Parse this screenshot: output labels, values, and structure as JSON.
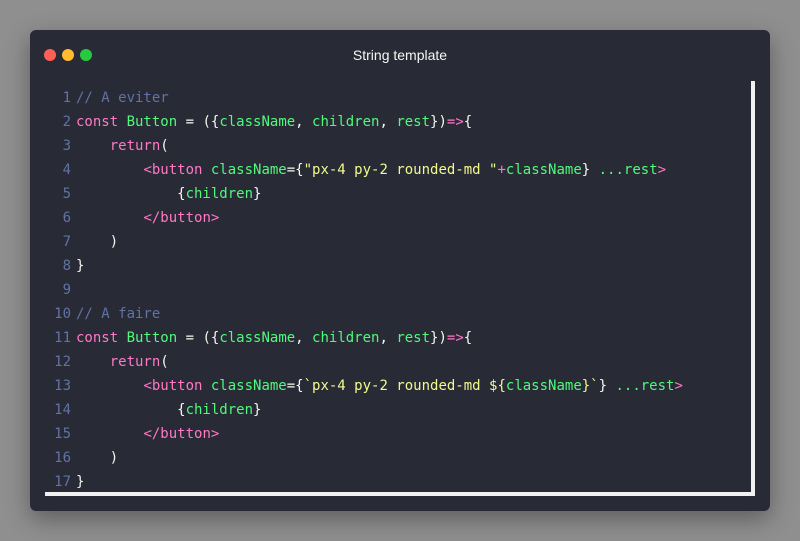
{
  "window": {
    "title": "String template"
  },
  "colors": {
    "background": "#282a36",
    "comment": "#6272a4",
    "keyword": "#ff79c6",
    "identifier": "#50fa7b",
    "string": "#f1fa8c",
    "plain": "#f8f8f2"
  },
  "icons": [
    "close-dot",
    "minimize-dot",
    "maximize-dot"
  ],
  "code": {
    "lines": [
      {
        "n": "1",
        "tokens": [
          {
            "t": "// A eviter",
            "c": "comment"
          }
        ]
      },
      {
        "n": "2",
        "tokens": [
          {
            "t": "const ",
            "c": "kw"
          },
          {
            "t": "Button",
            "c": "id"
          },
          {
            "t": " = ({",
            "c": "pl"
          },
          {
            "t": "className",
            "c": "id"
          },
          {
            "t": ", ",
            "c": "pl"
          },
          {
            "t": "children",
            "c": "id"
          },
          {
            "t": ", ",
            "c": "pl"
          },
          {
            "t": "rest",
            "c": "id"
          },
          {
            "t": "})",
            "c": "pl"
          },
          {
            "t": "=>",
            "c": "kw"
          },
          {
            "t": "{",
            "c": "pl"
          }
        ]
      },
      {
        "n": "3",
        "tokens": [
          {
            "t": "    ",
            "c": "pl"
          },
          {
            "t": "return",
            "c": "kw"
          },
          {
            "t": "(",
            "c": "pl"
          }
        ]
      },
      {
        "n": "4",
        "tokens": [
          {
            "t": "        ",
            "c": "pl"
          },
          {
            "t": "<button ",
            "c": "kw"
          },
          {
            "t": "className",
            "c": "id"
          },
          {
            "t": "={",
            "c": "pl"
          },
          {
            "t": "\"px-4 py-2 rounded-md \"",
            "c": "str"
          },
          {
            "t": "+",
            "c": "kw"
          },
          {
            "t": "className",
            "c": "id"
          },
          {
            "t": "} ",
            "c": "pl"
          },
          {
            "t": "...rest",
            "c": "id"
          },
          {
            "t": ">",
            "c": "kw"
          }
        ]
      },
      {
        "n": "5",
        "tokens": [
          {
            "t": "            {",
            "c": "pl"
          },
          {
            "t": "children",
            "c": "id"
          },
          {
            "t": "}",
            "c": "pl"
          }
        ]
      },
      {
        "n": "6",
        "tokens": [
          {
            "t": "        ",
            "c": "pl"
          },
          {
            "t": "</button>",
            "c": "kw"
          }
        ]
      },
      {
        "n": "7",
        "tokens": [
          {
            "t": "    )",
            "c": "pl"
          }
        ]
      },
      {
        "n": "8",
        "tokens": [
          {
            "t": "}",
            "c": "pl"
          }
        ]
      },
      {
        "n": "9",
        "tokens": []
      },
      {
        "n": "10",
        "tokens": [
          {
            "t": "// A faire",
            "c": "comment"
          }
        ]
      },
      {
        "n": "11",
        "tokens": [
          {
            "t": "const ",
            "c": "kw"
          },
          {
            "t": "Button",
            "c": "id"
          },
          {
            "t": " = ({",
            "c": "pl"
          },
          {
            "t": "className",
            "c": "id"
          },
          {
            "t": ", ",
            "c": "pl"
          },
          {
            "t": "children",
            "c": "id"
          },
          {
            "t": ", ",
            "c": "pl"
          },
          {
            "t": "rest",
            "c": "id"
          },
          {
            "t": "})",
            "c": "pl"
          },
          {
            "t": "=>",
            "c": "kw"
          },
          {
            "t": "{",
            "c": "pl"
          }
        ]
      },
      {
        "n": "12",
        "tokens": [
          {
            "t": "    ",
            "c": "pl"
          },
          {
            "t": "return",
            "c": "kw"
          },
          {
            "t": "(",
            "c": "pl"
          }
        ]
      },
      {
        "n": "13",
        "tokens": [
          {
            "t": "        ",
            "c": "pl"
          },
          {
            "t": "<button ",
            "c": "kw"
          },
          {
            "t": "className",
            "c": "id"
          },
          {
            "t": "={",
            "c": "pl"
          },
          {
            "t": "`px-4 py-2 rounded-md ${",
            "c": "str"
          },
          {
            "t": "className",
            "c": "id"
          },
          {
            "t": "}`",
            "c": "str"
          },
          {
            "t": "} ",
            "c": "pl"
          },
          {
            "t": "...rest",
            "c": "id"
          },
          {
            "t": ">",
            "c": "kw"
          }
        ]
      },
      {
        "n": "14",
        "tokens": [
          {
            "t": "            {",
            "c": "pl"
          },
          {
            "t": "children",
            "c": "id"
          },
          {
            "t": "}",
            "c": "pl"
          }
        ]
      },
      {
        "n": "15",
        "tokens": [
          {
            "t": "        ",
            "c": "pl"
          },
          {
            "t": "</button>",
            "c": "kw"
          }
        ]
      },
      {
        "n": "16",
        "tokens": [
          {
            "t": "    )",
            "c": "pl"
          }
        ]
      },
      {
        "n": "17",
        "tokens": [
          {
            "t": "}",
            "c": "pl"
          }
        ]
      }
    ]
  }
}
